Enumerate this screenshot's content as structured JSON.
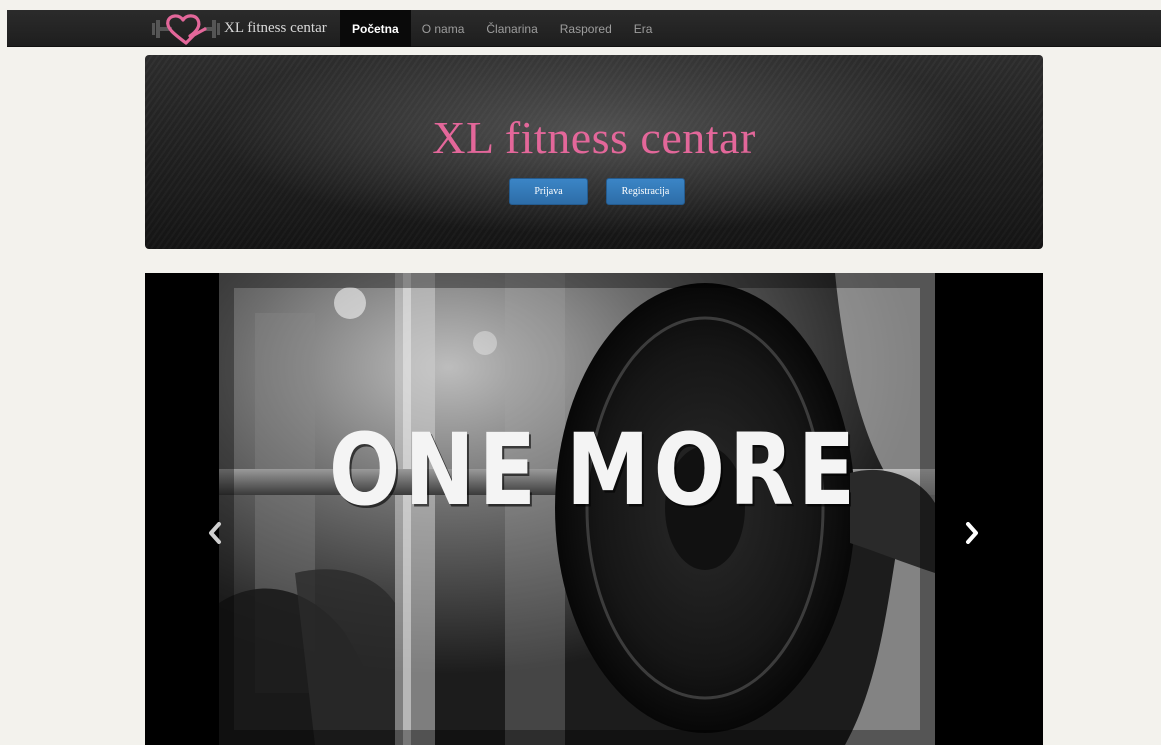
{
  "brand": {
    "name": "XL fitness centar"
  },
  "nav": {
    "items": [
      {
        "label": "Početna",
        "active": true
      },
      {
        "label": "O nama",
        "active": false
      },
      {
        "label": "Članarina",
        "active": false
      },
      {
        "label": "Raspored",
        "active": false
      },
      {
        "label": "Era",
        "active": false
      }
    ]
  },
  "hero": {
    "title": "XL fitness centar",
    "login_label": "Prijava",
    "register_label": "Registracija"
  },
  "carousel": {
    "slide_caption_word1": "ONE",
    "slide_caption_word2": "MORE",
    "prev_icon": "chevron-left-icon",
    "next_icon": "chevron-right-icon"
  },
  "colors": {
    "accent_pink": "#e3679a",
    "button_blue": "#3379b8",
    "navbar_dark": "#222222",
    "page_background": "#f3f2ed"
  }
}
